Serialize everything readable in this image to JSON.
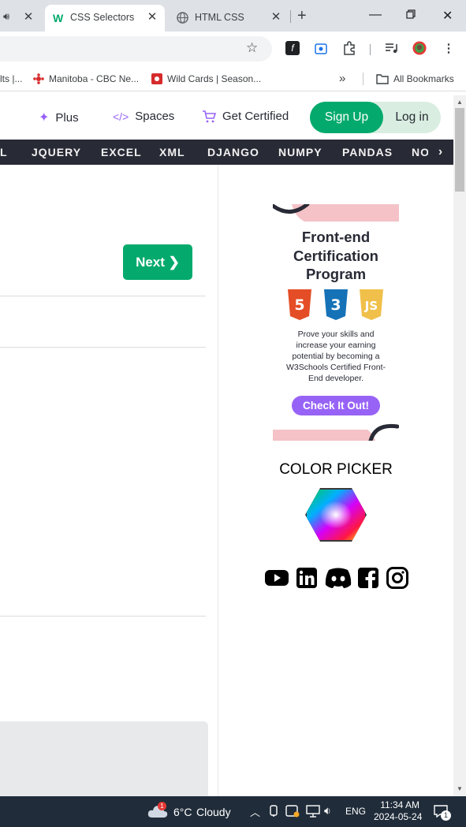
{
  "browser": {
    "tabs": [
      {
        "title": "",
        "audio_icon": "speaker-icon",
        "active": false
      },
      {
        "title": "CSS Selectors",
        "active": true
      },
      {
        "title": "HTML CSS",
        "active": false
      }
    ],
    "bookmarks": [
      {
        "label": "lts |..."
      },
      {
        "label": "Manitoba - CBC Ne..."
      },
      {
        "label": "Wild Cards | Season..."
      }
    ],
    "all_bookmarks": "All Bookmarks",
    "overflow": "»"
  },
  "header": {
    "plus": "Plus",
    "spaces": "Spaces",
    "get_certified": "Get Certified",
    "sign_up": "Sign Up",
    "log_in": "Log in"
  },
  "topnav": {
    "items": [
      "L",
      "JQUERY",
      "EXCEL",
      "XML",
      "DJANGO",
      "NUMPY",
      "PANDAS",
      "NO"
    ],
    "arrow": "›"
  },
  "main": {
    "next_label": "Next ❯"
  },
  "sidebar": {
    "ad": {
      "title_line1": "Front-end",
      "title_line2": "Certification",
      "title_line3": "Program",
      "body": "Prove your skills and increase your earning potential by becoming a W3Schools Certified Front-End developer.",
      "button": "Check It Out!",
      "badges": [
        "5",
        "3",
        "JS"
      ]
    },
    "color_picker_title": "COLOR PICKER",
    "socials": [
      "youtube-icon",
      "linkedin-icon",
      "discord-icon",
      "facebook-icon",
      "instagram-icon"
    ]
  },
  "taskbar": {
    "weather_badge": "1",
    "temperature": "6°C",
    "condition": "Cloudy",
    "language": "ENG",
    "time": "11:34 AM",
    "date": "2024-05-24",
    "notif_count": "1"
  },
  "colors": {
    "brand_green": "#04aa6d",
    "purple": "#9763f6",
    "dark_nav": "#282a35",
    "taskbar": "#202c39"
  }
}
